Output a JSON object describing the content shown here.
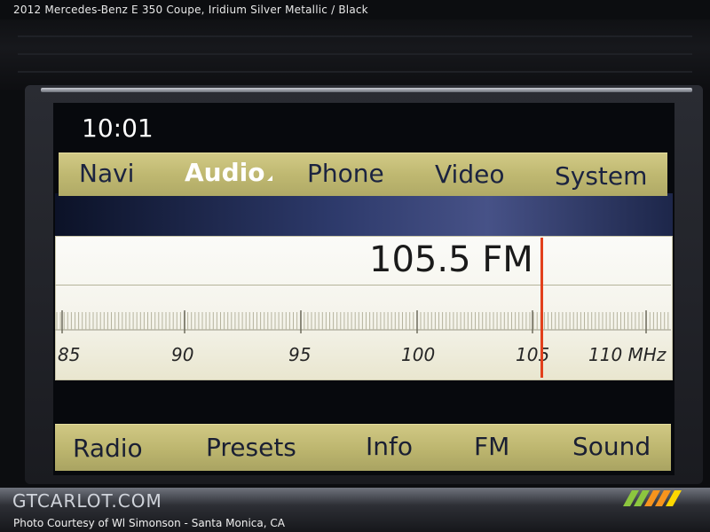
{
  "caption": {
    "text": "2012 Mercedes-Benz E 350 Coupe,  Iridium Silver Metallic / Black"
  },
  "display": {
    "clock": "10:01",
    "top_menu": {
      "items": [
        {
          "label": "Navi",
          "active": false
        },
        {
          "label": "Audio",
          "active": true
        },
        {
          "label": "Phone",
          "active": false
        },
        {
          "label": "Video",
          "active": false
        },
        {
          "label": "System",
          "active": false
        }
      ]
    },
    "tuner": {
      "frequency": "105.5 FM",
      "scale_labels": [
        "85",
        "90",
        "95",
        "100",
        "105",
        "110 MHz"
      ],
      "scale_min": 85,
      "scale_max": 110,
      "needle_value": 105.5,
      "needle_color": "#e2401c"
    },
    "bottom_menu": {
      "items": [
        {
          "label": "Radio"
        },
        {
          "label": "Presets"
        },
        {
          "label": "Info"
        },
        {
          "label": "FM"
        },
        {
          "label": "Sound"
        }
      ]
    }
  },
  "footer": {
    "watermark": "GTCARLOT.COM",
    "credit": "Photo Courtesy of Wl Simonson - Santa Monica, CA"
  },
  "colors": {
    "menu_bar": "#c6bf79",
    "menu_text": "#1b2340",
    "active_text": "#ffffff"
  }
}
